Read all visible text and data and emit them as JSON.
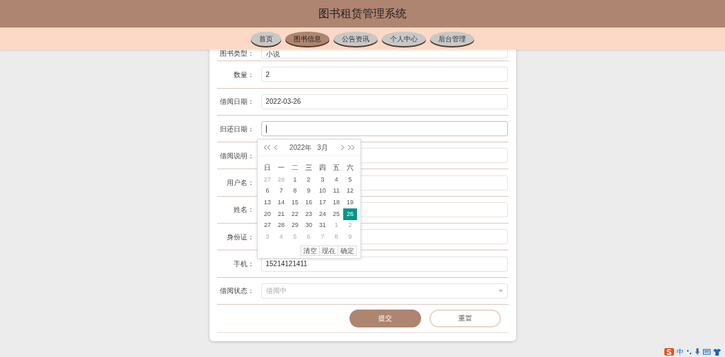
{
  "header": {
    "title": "图书租赁管理系统"
  },
  "nav": [
    {
      "label": "首页",
      "selected": false
    },
    {
      "label": "图书信息",
      "selected": true
    },
    {
      "label": "公告资讯",
      "selected": false
    },
    {
      "label": "个人中心",
      "selected": false
    },
    {
      "label": "后台管理",
      "selected": false
    }
  ],
  "form": {
    "fields": [
      {
        "label": "图书类型：",
        "kind": "input",
        "value": "小说",
        "focused": false
      },
      {
        "label": "数量：",
        "kind": "input",
        "value": "2",
        "focused": false
      },
      {
        "label": "借阅日期：",
        "kind": "input",
        "value": "2022-03-26",
        "focused": false
      },
      {
        "label": "归还日期：",
        "kind": "input",
        "focused": true
      },
      {
        "label": "借阅说明：",
        "kind": "input",
        "focused": false
      },
      {
        "label": "用户名：",
        "kind": "input",
        "focused": false
      },
      {
        "label": "姓名：",
        "kind": "input",
        "focused": false
      },
      {
        "label": "身份证：",
        "kind": "input",
        "focused": false
      },
      {
        "label": "手机：",
        "kind": "input",
        "value": "15214121411",
        "focused": false
      },
      {
        "label": "借阅状态：",
        "kind": "select",
        "placeholder": "借阅中",
        "focused": false
      }
    ],
    "actions": [
      {
        "label": "提交",
        "kind": "primary"
      },
      {
        "label": "重置",
        "kind": "secondary"
      }
    ]
  },
  "datepicker": {
    "year": "2022年",
    "month": "3月",
    "weekdays": [
      "日",
      "一",
      "二",
      "三",
      "四",
      "五",
      "六"
    ],
    "days": [
      {
        "day": "27",
        "muted": true,
        "selected": false
      },
      {
        "day": "28",
        "muted": true,
        "selected": false
      },
      {
        "day": "1",
        "muted": false,
        "selected": false
      },
      {
        "day": "2",
        "muted": false,
        "selected": false
      },
      {
        "day": "3",
        "muted": false,
        "selected": false
      },
      {
        "day": "4",
        "muted": false,
        "selected": false
      },
      {
        "day": "5",
        "muted": false,
        "selected": false
      },
      {
        "day": "6",
        "muted": false,
        "selected": false
      },
      {
        "day": "7",
        "muted": false,
        "selected": false
      },
      {
        "day": "8",
        "muted": false,
        "selected": false
      },
      {
        "day": "9",
        "muted": false,
        "selected": false
      },
      {
        "day": "10",
        "muted": false,
        "selected": false
      },
      {
        "day": "11",
        "muted": false,
        "selected": false
      },
      {
        "day": "12",
        "muted": false,
        "selected": false
      },
      {
        "day": "13",
        "muted": false,
        "selected": false
      },
      {
        "day": "14",
        "muted": false,
        "selected": false
      },
      {
        "day": "15",
        "muted": false,
        "selected": false
      },
      {
        "day": "16",
        "muted": false,
        "selected": false
      },
      {
        "day": "17",
        "muted": false,
        "selected": false
      },
      {
        "day": "18",
        "muted": false,
        "selected": false
      },
      {
        "day": "19",
        "muted": false,
        "selected": false
      },
      {
        "day": "20",
        "muted": false,
        "selected": false
      },
      {
        "day": "21",
        "muted": false,
        "selected": false
      },
      {
        "day": "22",
        "muted": false,
        "selected": false
      },
      {
        "day": "23",
        "muted": false,
        "selected": false
      },
      {
        "day": "24",
        "muted": false,
        "selected": false
      },
      {
        "day": "25",
        "muted": false,
        "selected": false
      },
      {
        "day": "26",
        "muted": false,
        "selected": true
      },
      {
        "day": "27",
        "muted": false,
        "selected": false
      },
      {
        "day": "28",
        "muted": false,
        "selected": false
      },
      {
        "day": "29",
        "muted": false,
        "selected": false
      },
      {
        "day": "30",
        "muted": false,
        "selected": false
      },
      {
        "day": "31",
        "muted": false,
        "selected": false
      },
      {
        "day": "1",
        "muted": true,
        "selected": false
      },
      {
        "day": "2",
        "muted": true,
        "selected": false
      },
      {
        "day": "3",
        "muted": true,
        "selected": false
      },
      {
        "day": "4",
        "muted": true,
        "selected": false
      },
      {
        "day": "5",
        "muted": true,
        "selected": false
      },
      {
        "day": "6",
        "muted": true,
        "selected": false
      },
      {
        "day": "7",
        "muted": true,
        "selected": false
      },
      {
        "day": "8",
        "muted": true,
        "selected": false
      },
      {
        "day": "9",
        "muted": true,
        "selected": false
      }
    ],
    "buttons": [
      "清空",
      "现在",
      "确定"
    ]
  },
  "ime": {
    "mode": "中"
  }
}
